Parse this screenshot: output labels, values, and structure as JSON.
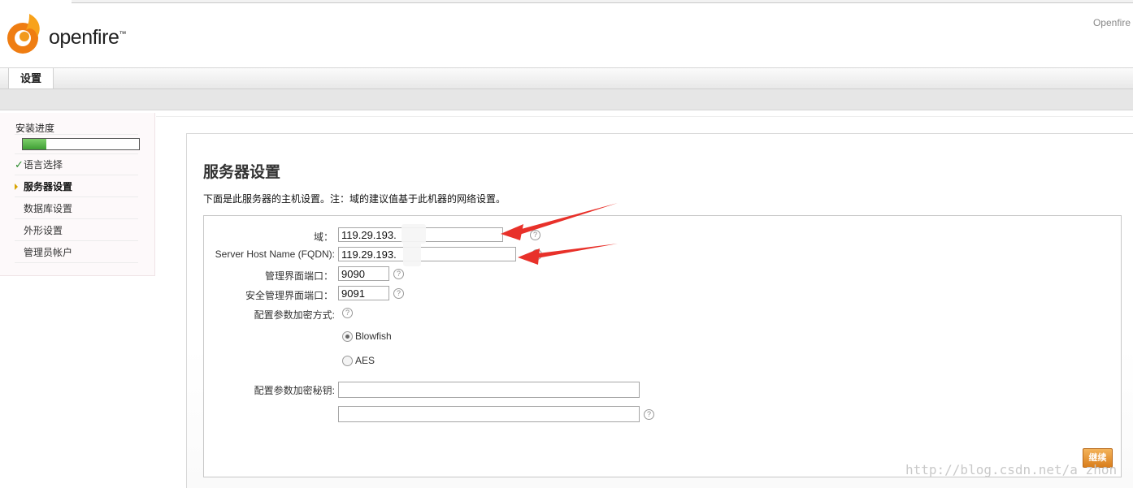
{
  "brand": {
    "logo_text": "openfire",
    "right_text": "Openfire"
  },
  "nav": {
    "tab_settings": "设置"
  },
  "sidebar": {
    "title": "安装进度",
    "progress_fraction": 0.2,
    "check_mark": "✓",
    "items": [
      {
        "label": "语言选择",
        "state": "done"
      },
      {
        "label": "服务器设置",
        "state": "current"
      },
      {
        "label": "数据库设置",
        "state": "pending"
      },
      {
        "label": "外形设置",
        "state": "pending"
      },
      {
        "label": "管理员帐户",
        "state": "pending"
      }
    ]
  },
  "main": {
    "title": "服务器设置",
    "description": "下面是此服务器的主机设置。注：域的建议值基于此机器的网络设置。"
  },
  "form": {
    "domain_label": "域：",
    "domain_value": "119.29.193.",
    "fqdn_label": "Server Host Name (FQDN):",
    "fqdn_value": "119.29.193.",
    "admin_port_label": "管理界面端口：",
    "admin_port_value": "9090",
    "secure_port_label": "安全管理界面端口：",
    "secure_port_value": "9091",
    "encryption_label": "配置参数加密方式:",
    "option_blowfish": "Blowfish",
    "option_aes": "AES",
    "selected_option": "Blowfish",
    "key_label": "配置参数加密秘钥:",
    "key_value": "",
    "key_confirm_value": "",
    "help_glyph": "?",
    "continue_label": "继续"
  },
  "watermark": "http://blog.csdn.net/a_zhon",
  "colors": {
    "annotation_arrow": "#e8312a",
    "progress": "#4caf3a",
    "continue": "#e48e2a"
  }
}
